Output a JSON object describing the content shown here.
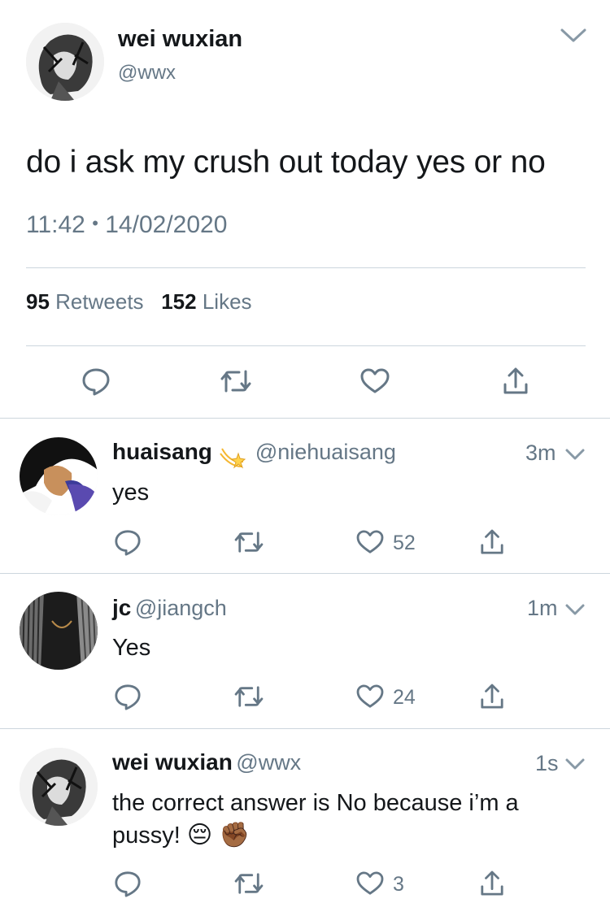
{
  "main_tweet": {
    "author_name": "wei wuxian",
    "author_handle": "@wwx",
    "text": "do i ask my crush out today yes or no",
    "time": "11:42",
    "separator": "•",
    "date": "14/02/2020",
    "retweet_count": "95",
    "retweet_label": "Retweets",
    "like_count": "152",
    "like_label": "Likes"
  },
  "replies": [
    {
      "name": "huaisang",
      "handle": "@niehuaisang",
      "time": "3m",
      "text": "yes",
      "likes": "52"
    },
    {
      "name": "jc",
      "handle": "@jiangch",
      "time": "1m",
      "text": "Yes",
      "likes": "24"
    },
    {
      "name": "wei wuxian",
      "handle": "@wwx",
      "time": "1s",
      "text_line1": "the correct answer is No because i’m a",
      "text_line2": "pussy!",
      "emoji": "😔 ✊🏾",
      "likes": "3"
    }
  ],
  "colors": {
    "text": "#14171a",
    "secondary": "#657786",
    "divider": "#ccd6dd"
  }
}
